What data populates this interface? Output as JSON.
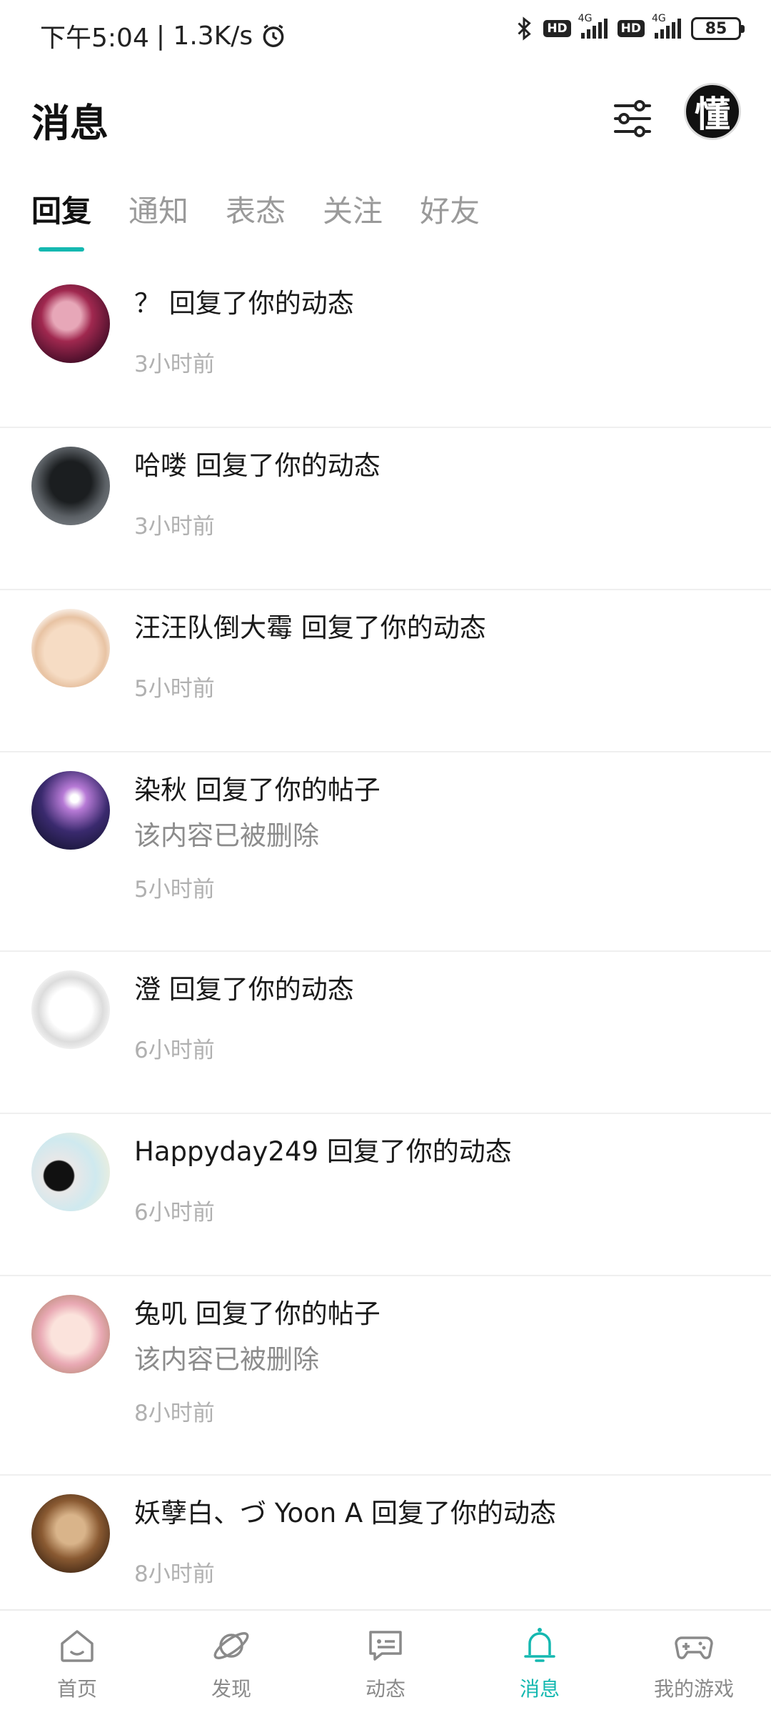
{
  "status_bar": {
    "time": "下午5:04",
    "speed": "| 1.3K/s",
    "hd_label": "HD",
    "net_label": "4G",
    "battery": "85"
  },
  "header": {
    "title": "消息",
    "avatar_char": "懂"
  },
  "tabs": [
    {
      "label": "回复",
      "active": true
    },
    {
      "label": "通知",
      "active": false
    },
    {
      "label": "表态",
      "active": false
    },
    {
      "label": "关注",
      "active": false
    },
    {
      "label": "好友",
      "active": false
    }
  ],
  "messages": [
    {
      "name": "？",
      "action": "回复了你的动态",
      "deleted": "",
      "time": "3小时前",
      "avatar_color": "#7a1f4a"
    },
    {
      "name": "哈喽",
      "action": "回复了你的动态",
      "deleted": "",
      "time": "3小时前",
      "avatar_color": "#3b4045"
    },
    {
      "name": "汪汪队倒大霉",
      "action": "回复了你的动态",
      "deleted": "",
      "time": "5小时前",
      "avatar_color": "#f3e3cf"
    },
    {
      "name": "染秋",
      "action": "回复了你的帖子",
      "deleted": "该内容已被删除",
      "time": "5小时前",
      "avatar_color": "#3a2a6e"
    },
    {
      "name": "澄",
      "action": "回复了你的动态",
      "deleted": "",
      "time": "6小时前",
      "avatar_color": "#f4f4f4"
    },
    {
      "name": "Happyday249",
      "action": "回复了你的动态",
      "deleted": "",
      "time": "6小时前",
      "avatar_color": "#dfeee9"
    },
    {
      "name": "兔叽",
      "action": "回复了你的帖子",
      "deleted": "该内容已被删除",
      "time": "8小时前",
      "avatar_color": "#f3d3cf"
    },
    {
      "name": "妖孽白、づ Yoon A",
      "action": "回复了你的动态",
      "deleted": "",
      "time": "8小时前",
      "avatar_color": "#5a3a22"
    }
  ],
  "bottom_nav": [
    {
      "label": "首页",
      "icon": "home-icon",
      "active": false
    },
    {
      "label": "发现",
      "icon": "planet-icon",
      "active": false
    },
    {
      "label": "动态",
      "icon": "chat-icon",
      "active": false
    },
    {
      "label": "消息",
      "icon": "bell-icon",
      "active": true
    },
    {
      "label": "我的游戏",
      "icon": "gamepad-icon",
      "active": false
    }
  ],
  "colors": {
    "accent": "#14b8b0",
    "muted": "#9a9a9a"
  }
}
